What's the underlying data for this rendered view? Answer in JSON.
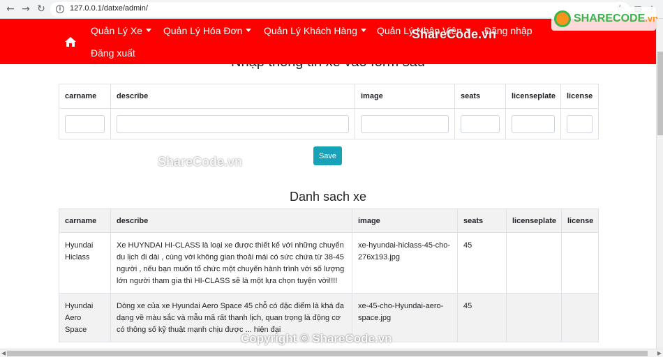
{
  "browser": {
    "url": "127.0.0.1/datxe/admin/"
  },
  "navbar": {
    "items": [
      {
        "label": "Quản Lý Xe",
        "dropdown": true
      },
      {
        "label": "Quản Lý Hóa Đơn",
        "dropdown": true
      },
      {
        "label": "Quản Lý Khách Hàng",
        "dropdown": true
      },
      {
        "label": "Quản Lý Nhân Viên",
        "dropdown": true
      },
      {
        "label": "Đăng nhập",
        "dropdown": false
      },
      {
        "label": "Đăng xuất",
        "dropdown": false
      }
    ]
  },
  "form": {
    "title": "Nhập thông tin xe vào form sau",
    "columns": [
      "carname",
      "describe",
      "image",
      "seats",
      "licenseplate",
      "license"
    ],
    "save_label": "Save"
  },
  "list": {
    "title": "Danh sach xe",
    "columns": [
      "carname",
      "describe",
      "image",
      "seats",
      "licenseplate",
      "license"
    ],
    "rows": [
      {
        "carname": "Hyundai Hiclass",
        "describe": "Xe HUYNDAI HI-CLASS là loại xe được thiết kế với những chuyến du lịch đi dài , cùng với không gian thoải mái có sức chứa từ 38-45 người , nếu bạn muốn tổ chức một chuyến hành trình với số lượng lớn người tham gia thì HI-CLASS sẽ là một lựa chọn tuyện vời!!!!",
        "image": "xe-hyundai-hiclass-45-cho-276x193.jpg",
        "seats": "45",
        "licenseplate": "",
        "license": ""
      },
      {
        "carname": "Hyundai Aero Space",
        "describe": "Dòng xe của xe Hyundai Aero Space 45 chỗ có đặc điểm là khá đa dạng về màu sắc và mẫu mã rất thanh lịch, quan trọng là động cơ có thông số kỹ thuật mạnh chịu được ... hiện đại",
        "image": "xe-45-cho-Hyundai-aero-space.jpg",
        "seats": "45",
        "licenseplate": "",
        "license": ""
      }
    ]
  },
  "watermarks": {
    "logo_text": "SHARECODE",
    "logo_suffix": ".vn",
    "nav_watermark": "ShareCode.vn",
    "mid_watermark": "ShareCode.vn",
    "footer_watermark": "Copyright © ShareCode.vn"
  },
  "colors": {
    "navbar": "#ff0000",
    "save_button": "#17a2b8"
  }
}
